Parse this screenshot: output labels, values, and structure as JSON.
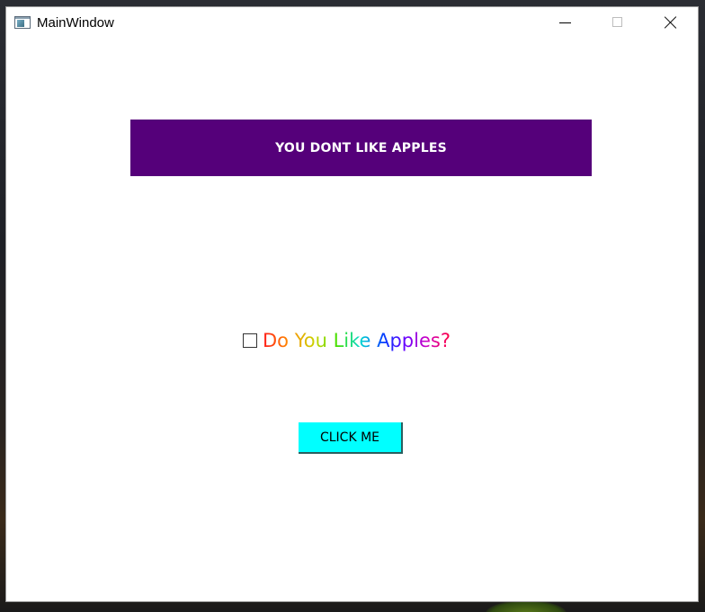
{
  "window": {
    "title": "MainWindow",
    "icon": "app-window-icon"
  },
  "caption_buttons": {
    "minimize": "minimize-icon",
    "maximize": "maximize-icon",
    "close": "close-icon"
  },
  "main": {
    "result_text": "YOU DONT LIKE APPLES",
    "result_background": "#55007a",
    "checkbox_checked": false,
    "question_label": "Do You Like Apples?",
    "button_label": "CLICK ME",
    "button_color": "#00ffff"
  }
}
